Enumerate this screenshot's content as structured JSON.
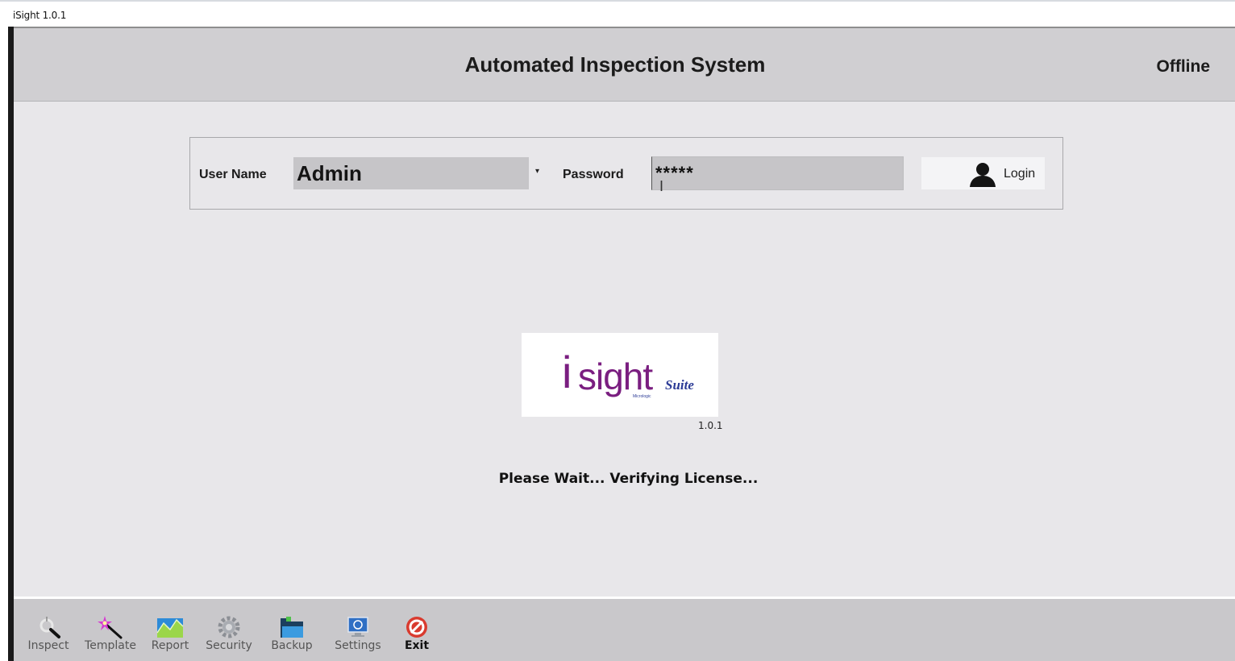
{
  "window": {
    "title": "iSight 1.0.1"
  },
  "header": {
    "title": "Automated Inspection System",
    "status": "Offline"
  },
  "login": {
    "username_label": "User Name",
    "username_value": "Admin",
    "username_dropdown": "▾",
    "password_label": "Password",
    "password_value": "*****",
    "login_label": "Login"
  },
  "logo": {
    "i": "i",
    "sight": "sight",
    "suite": "Suite",
    "tagline": "Micrologic",
    "version": "1.0.1"
  },
  "message": "Please Wait... Verifying License...",
  "toolbar": {
    "items": [
      {
        "label": "Inspect",
        "icon": "magnifier-icon"
      },
      {
        "label": "Template",
        "icon": "magic-wand-icon"
      },
      {
        "label": "Report",
        "icon": "chart-icon"
      },
      {
        "label": "Security",
        "icon": "gear-icon"
      },
      {
        "label": "Backup",
        "icon": "folder-icon"
      },
      {
        "label": "Settings",
        "icon": "monitor-icon"
      },
      {
        "label": "Exit",
        "icon": "exit-icon"
      }
    ]
  }
}
